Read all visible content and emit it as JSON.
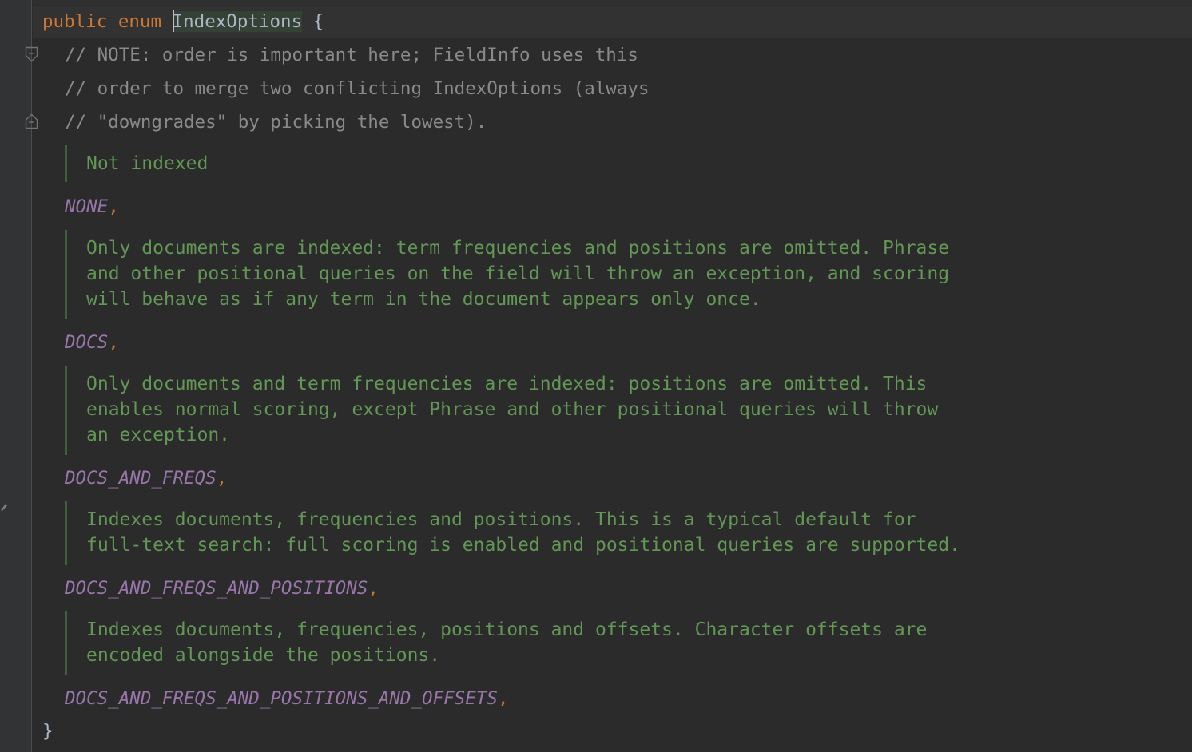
{
  "editor": {
    "declaration": {
      "modifier": "public",
      "keyword": "enum",
      "class_name": "IndexOptions",
      "open_brace": "{"
    },
    "comment_lines": [
      "// NOTE: order is important here; FieldInfo uses this",
      "// order to merge two conflicting IndexOptions (always",
      "// \"downgrades\" by picking the lowest)."
    ],
    "members": [
      {
        "doc": [
          "Not indexed"
        ],
        "name": "NONE",
        "comma": ","
      },
      {
        "doc": [
          "Only documents are indexed: term frequencies and positions are omitted. Phrase",
          "and other positional queries on the field will throw an exception, and scoring",
          "will behave as if any term in the document appears only once."
        ],
        "name": "DOCS",
        "comma": ","
      },
      {
        "doc": [
          "Only documents and term frequencies are indexed: positions are omitted. This",
          "enables normal scoring, except Phrase and other positional queries will throw",
          "an exception."
        ],
        "name": "DOCS_AND_FREQS",
        "comma": ","
      },
      {
        "doc": [
          "Indexes documents, frequencies and positions. This is a typical default for",
          "full-text search: full scoring is enabled and positional queries are supported."
        ],
        "name": "DOCS_AND_FREQS_AND_POSITIONS",
        "comma": ","
      },
      {
        "doc": [
          "Indexes documents, frequencies, positions and offsets. Character offsets are",
          "encoded alongside the positions."
        ],
        "name": "DOCS_AND_FREQS_AND_POSITIONS_AND_OFFSETS",
        "comma": ","
      }
    ],
    "close_brace": "}"
  },
  "icons": {
    "fold_start": "fold-start-icon",
    "fold_end": "fold-end-icon",
    "gutter_mark": "edit-marker-icon"
  },
  "colors": {
    "background": "#2b2b2b",
    "keyword": "#cc7832",
    "comment": "#8a8a8a",
    "doc_comment": "#629755",
    "constant": "#9876aa",
    "text": "#a9b7c6"
  }
}
